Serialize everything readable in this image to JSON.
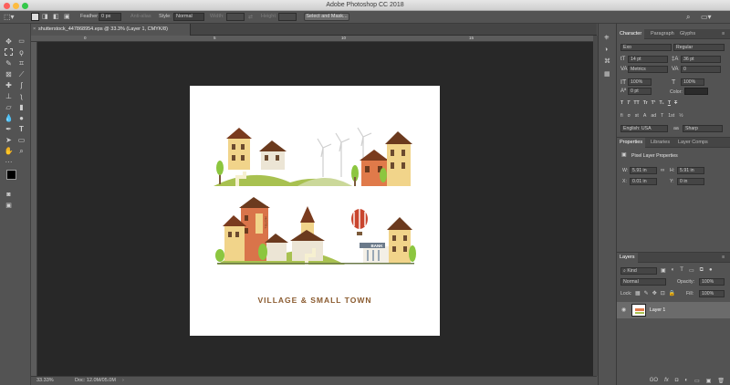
{
  "window": {
    "title": "Adobe Photoshop CC 2018"
  },
  "options_bar": {
    "feather_label": "Feather:",
    "feather_value": "0 px",
    "antialias_label": "Anti-alias",
    "style_label": "Style:",
    "style_value": "Normal",
    "width_label": "Width:",
    "height_label": "Height:",
    "select_mask_button": "Select and Mask..."
  },
  "document": {
    "tab_label": "shutterstock_447868954.eps @ 33.3% (Layer 1, CMYK/8)",
    "artwork_caption": "VILLAGE & SMALL TOWN",
    "sign_bank": "BANK",
    "sign_hotel": "HOTEL"
  },
  "ruler_ticks": [
    "0",
    "5",
    "10",
    "15"
  ],
  "status_bar": {
    "zoom": "33.33%",
    "doc_info": "Doc: 12.0M/05.0M"
  },
  "character_panel": {
    "tabs": [
      "Character",
      "Paragraph",
      "Glyphs"
    ],
    "font_family": "Exo",
    "font_style": "Regular",
    "font_size": "14 pt",
    "leading": "36 pt",
    "kerning": "Metrics",
    "tracking": "0",
    "vertical_scale": "100%",
    "horizontal_scale": "100%",
    "baseline_shift": "0 pt",
    "color_label": "Color:",
    "type_styles": [
      "T",
      "T",
      "TT",
      "Tr",
      "T¹",
      "T₁",
      "T",
      "T"
    ],
    "opentype_icons": [
      "fi",
      "σ",
      "st",
      "A",
      "ad",
      "T",
      "1st",
      "½"
    ],
    "language": "English: USA",
    "antialias": "Sharp",
    "antialias_prefix": "aa"
  },
  "properties_panel": {
    "tabs": [
      "Properties",
      "Libraries",
      "Layer Comps"
    ],
    "heading": "Pixel Layer Properties",
    "w_label": "W:",
    "w_value": "5.91 in",
    "h_label": "H:",
    "h_value": "5.91 in",
    "x_label": "X:",
    "x_value": "0.01 in",
    "y_label": "Y:",
    "y_value": "0 in"
  },
  "layers_panel": {
    "tabs": [
      "Layers"
    ],
    "filter_value": "Kind",
    "blend_mode": "Normal",
    "opacity_label": "Opacity:",
    "opacity_value": "100%",
    "lock_label": "Lock:",
    "fill_label": "Fill:",
    "fill_value": "100%",
    "layers": [
      {
        "name": "Layer 1",
        "visible": true
      }
    ],
    "footer_icons": [
      "GO",
      "fx",
      "◘",
      "◐",
      "▭",
      "▣",
      "🗑"
    ]
  },
  "colors": {
    "accent_caption": "#8a5a2e",
    "pasteboard": "#282828",
    "chrome": "#535353"
  }
}
